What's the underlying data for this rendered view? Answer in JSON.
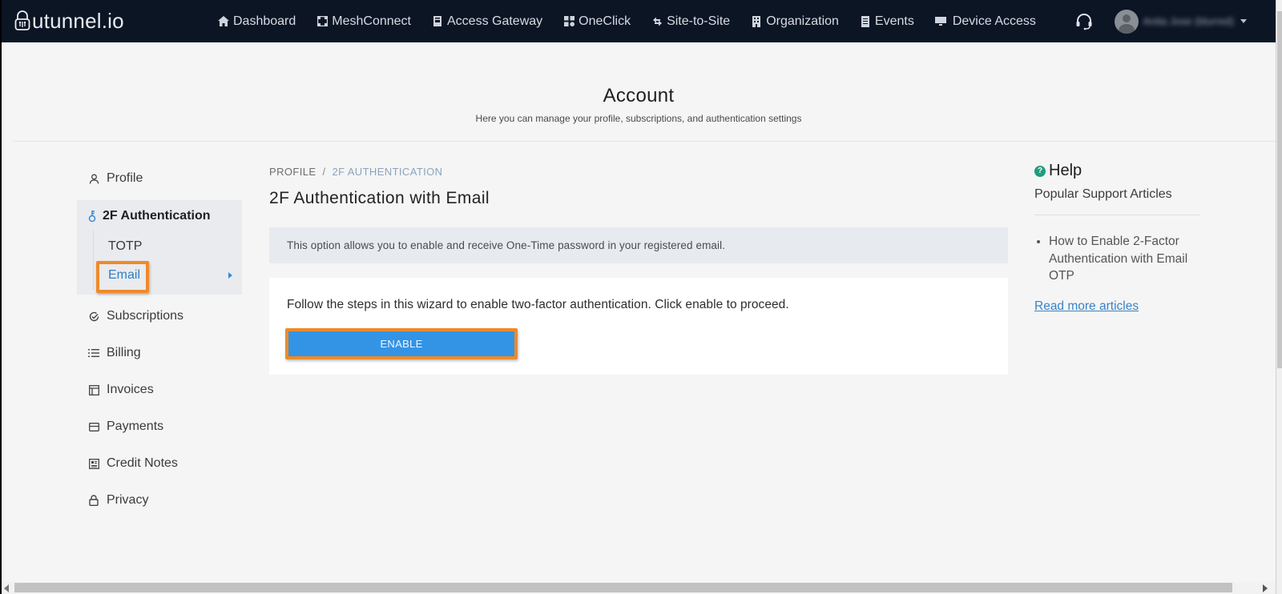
{
  "app": {
    "brand": "utunnel.io",
    "colors": {
      "nav_bg": "#0c1524",
      "accent_blue": "#3394e6",
      "highlight_orange": "#ec8a2b",
      "link_blue": "#3a82c4",
      "help_green": "#1f9d7c"
    }
  },
  "topnav": {
    "items": [
      {
        "label": "Dashboard",
        "icon": "home-icon"
      },
      {
        "label": "MeshConnect",
        "icon": "mesh-icon"
      },
      {
        "label": "Access Gateway",
        "icon": "gateway-icon"
      },
      {
        "label": "OneClick",
        "icon": "grid-icon"
      },
      {
        "label": "Site-to-Site",
        "icon": "arrows-exchange-icon"
      },
      {
        "label": "Organization",
        "icon": "building-icon"
      },
      {
        "label": "Events",
        "icon": "document-icon"
      },
      {
        "label": "Device Access",
        "icon": "monitor-icon"
      }
    ],
    "support_icon": "headset-icon",
    "user": {
      "name": "Anita Jose (blurred)"
    }
  },
  "header": {
    "title": "Account",
    "subtitle": "Here you can manage your profile, subscriptions, and authentication settings"
  },
  "sidebar": {
    "profile": {
      "label": "Profile",
      "icon": "user-icon"
    },
    "twofa": {
      "label": "2F Authentication",
      "icon": "key-icon",
      "children": [
        {
          "label": "TOTP",
          "active": false
        },
        {
          "label": "Email",
          "active": true
        }
      ]
    },
    "items": [
      {
        "label": "Subscriptions",
        "icon": "check-circle-icon"
      },
      {
        "label": "Billing",
        "icon": "list-icon"
      },
      {
        "label": "Invoices",
        "icon": "invoice-icon"
      },
      {
        "label": "Payments",
        "icon": "card-icon"
      },
      {
        "label": "Credit Notes",
        "icon": "credit-note-icon"
      },
      {
        "label": "Privacy",
        "icon": "lock-icon"
      }
    ]
  },
  "main": {
    "breadcrumb": {
      "root": "PROFILE",
      "separator": "/",
      "current": "2F AUTHENTICATION"
    },
    "title": "2F Authentication with Email",
    "info": "This option allows you to enable and receive One-Time password in your registered email.",
    "card_text": "Follow the steps in this wizard to enable two-factor authentication. Click enable to proceed.",
    "enable_label": "ENABLE"
  },
  "help": {
    "title": "Help",
    "subtitle": "Popular Support Articles",
    "articles": [
      "How to Enable 2-Factor Authentication with Email OTP"
    ],
    "more_label": "Read more articles"
  }
}
